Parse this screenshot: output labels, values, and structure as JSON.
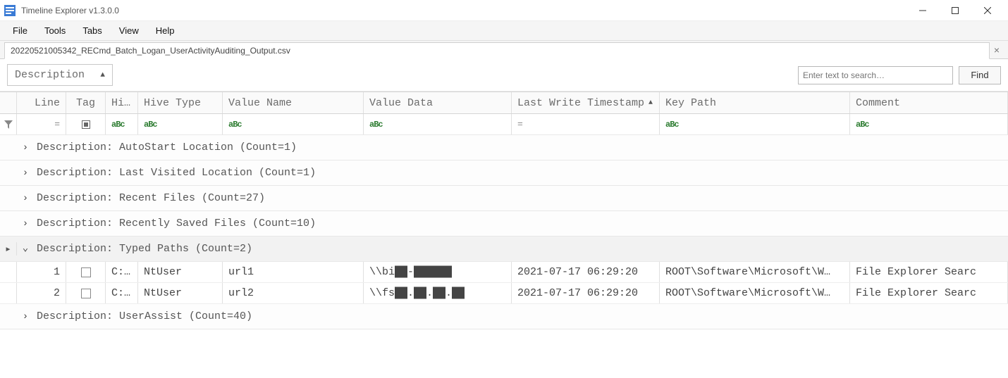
{
  "window": {
    "title": "Timeline Explorer v1.3.0.0"
  },
  "menu": {
    "file": "File",
    "tools": "Tools",
    "tabs": "Tabs",
    "view": "View",
    "help": "Help"
  },
  "tab": {
    "label": "20220521005342_RECmd_Batch_Logan_UserActivityAuditing_Output.csv"
  },
  "toolbar": {
    "group_field": "Description",
    "search_placeholder": "Enter text to search…",
    "find_label": "Find"
  },
  "columns": {
    "line": "Line",
    "tag": "Tag",
    "hive": "Hi…",
    "hive_type": "Hive Type",
    "value_name": "Value Name",
    "value_data": "Value Data",
    "last_write": "Last Write Timestamp",
    "key_path": "Key Path",
    "comment": "Comment"
  },
  "filters": {
    "line": "=",
    "last_write": "=",
    "abc": "aBc"
  },
  "groups": [
    {
      "label": "Description: AutoStart Location (Count=1)",
      "expanded": false
    },
    {
      "label": "Description: Last Visited Location (Count=1)",
      "expanded": false
    },
    {
      "label": "Description: Recent Files (Count=27)",
      "expanded": false
    },
    {
      "label": "Description: Recently Saved Files (Count=10)",
      "expanded": false
    },
    {
      "label": "Description: Typed Paths (Count=2)",
      "expanded": true
    },
    {
      "label": "Description: UserAssist (Count=40)",
      "expanded": false
    }
  ],
  "rows": [
    {
      "line": "1",
      "hive": "C:…",
      "hive_type": "NtUser",
      "value_name": "url1",
      "value_data": "\\\\bi██-██████",
      "last_write": "2021-07-17 06:29:20",
      "key_path": "ROOT\\Software\\Microsoft\\W…",
      "comment": "File Explorer Searc"
    },
    {
      "line": "2",
      "hive": "C:…",
      "hive_type": "NtUser",
      "value_name": "url2",
      "value_data": "\\\\fs██.██.██.██",
      "last_write": "2021-07-17 06:29:20",
      "key_path": "ROOT\\Software\\Microsoft\\W…",
      "comment": "File Explorer Searc"
    }
  ]
}
